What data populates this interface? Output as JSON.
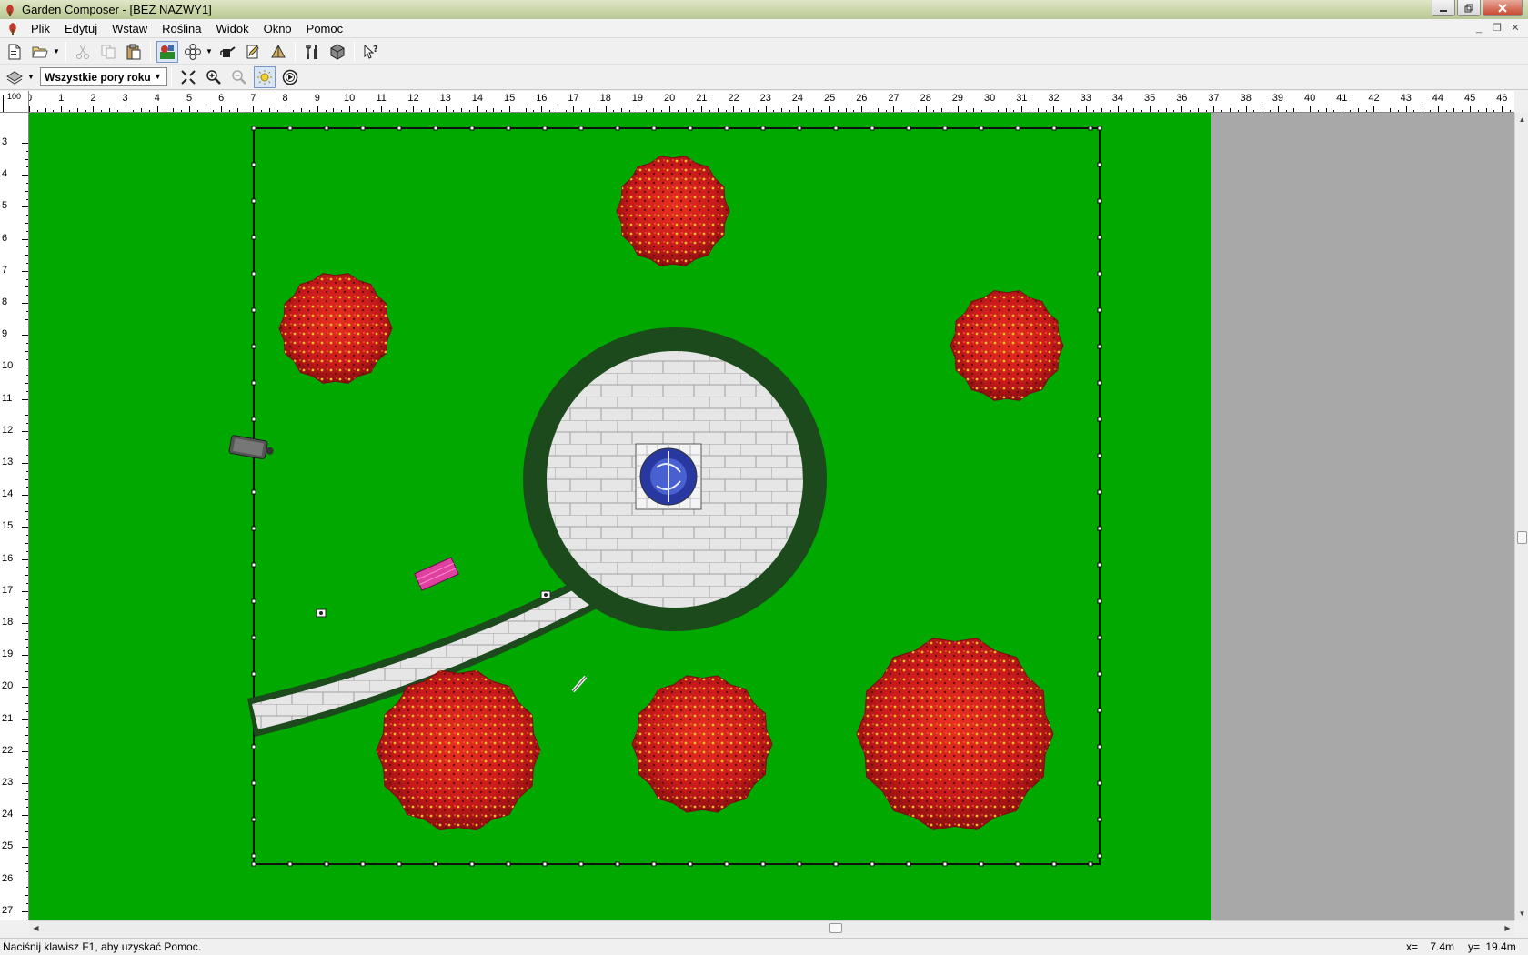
{
  "window": {
    "title": "Garden Composer - [BEZ NAZWY1]"
  },
  "menu": {
    "items": [
      "Plik",
      "Edytuj",
      "Wstaw",
      "Roślina",
      "Widok",
      "Okno",
      "Pomoc"
    ]
  },
  "toolbar2": {
    "season_select": "Wszystkie pory roku"
  },
  "rulers": {
    "corner_label": "100",
    "horizontal": [
      "0",
      "1",
      "2",
      "3",
      "4",
      "5",
      "6",
      "7",
      "8",
      "9",
      "10",
      "11",
      "12",
      "13",
      "14",
      "15",
      "16",
      "17",
      "18",
      "19",
      "20",
      "21",
      "22",
      "23",
      "24",
      "25",
      "26",
      "27",
      "28",
      "29",
      "30",
      "31",
      "32",
      "33",
      "34",
      "35",
      "36",
      "37",
      "38",
      "39",
      "40",
      "41",
      "42",
      "43",
      "44",
      "45",
      "46"
    ],
    "vertical": [
      "3",
      "4",
      "5",
      "6",
      "7",
      "8",
      "9",
      "10",
      "11",
      "12",
      "13",
      "14",
      "15",
      "16",
      "17",
      "18",
      "19",
      "20",
      "21",
      "22",
      "23",
      "24",
      "25",
      "26",
      "27"
    ]
  },
  "garden": {
    "lawn_color": "#00a800",
    "flower_color": "#c8191b",
    "hedge_color": "#1d4a1d",
    "paving_color": "#e6e6e6",
    "bench_color": "#e040a0"
  },
  "status": {
    "message": "Naciśnij klawisz F1, aby uzyskać Pomoc.",
    "x_label": "x=",
    "x_value": "7.4m",
    "y_label": "y=",
    "y_value": "19.4m"
  }
}
